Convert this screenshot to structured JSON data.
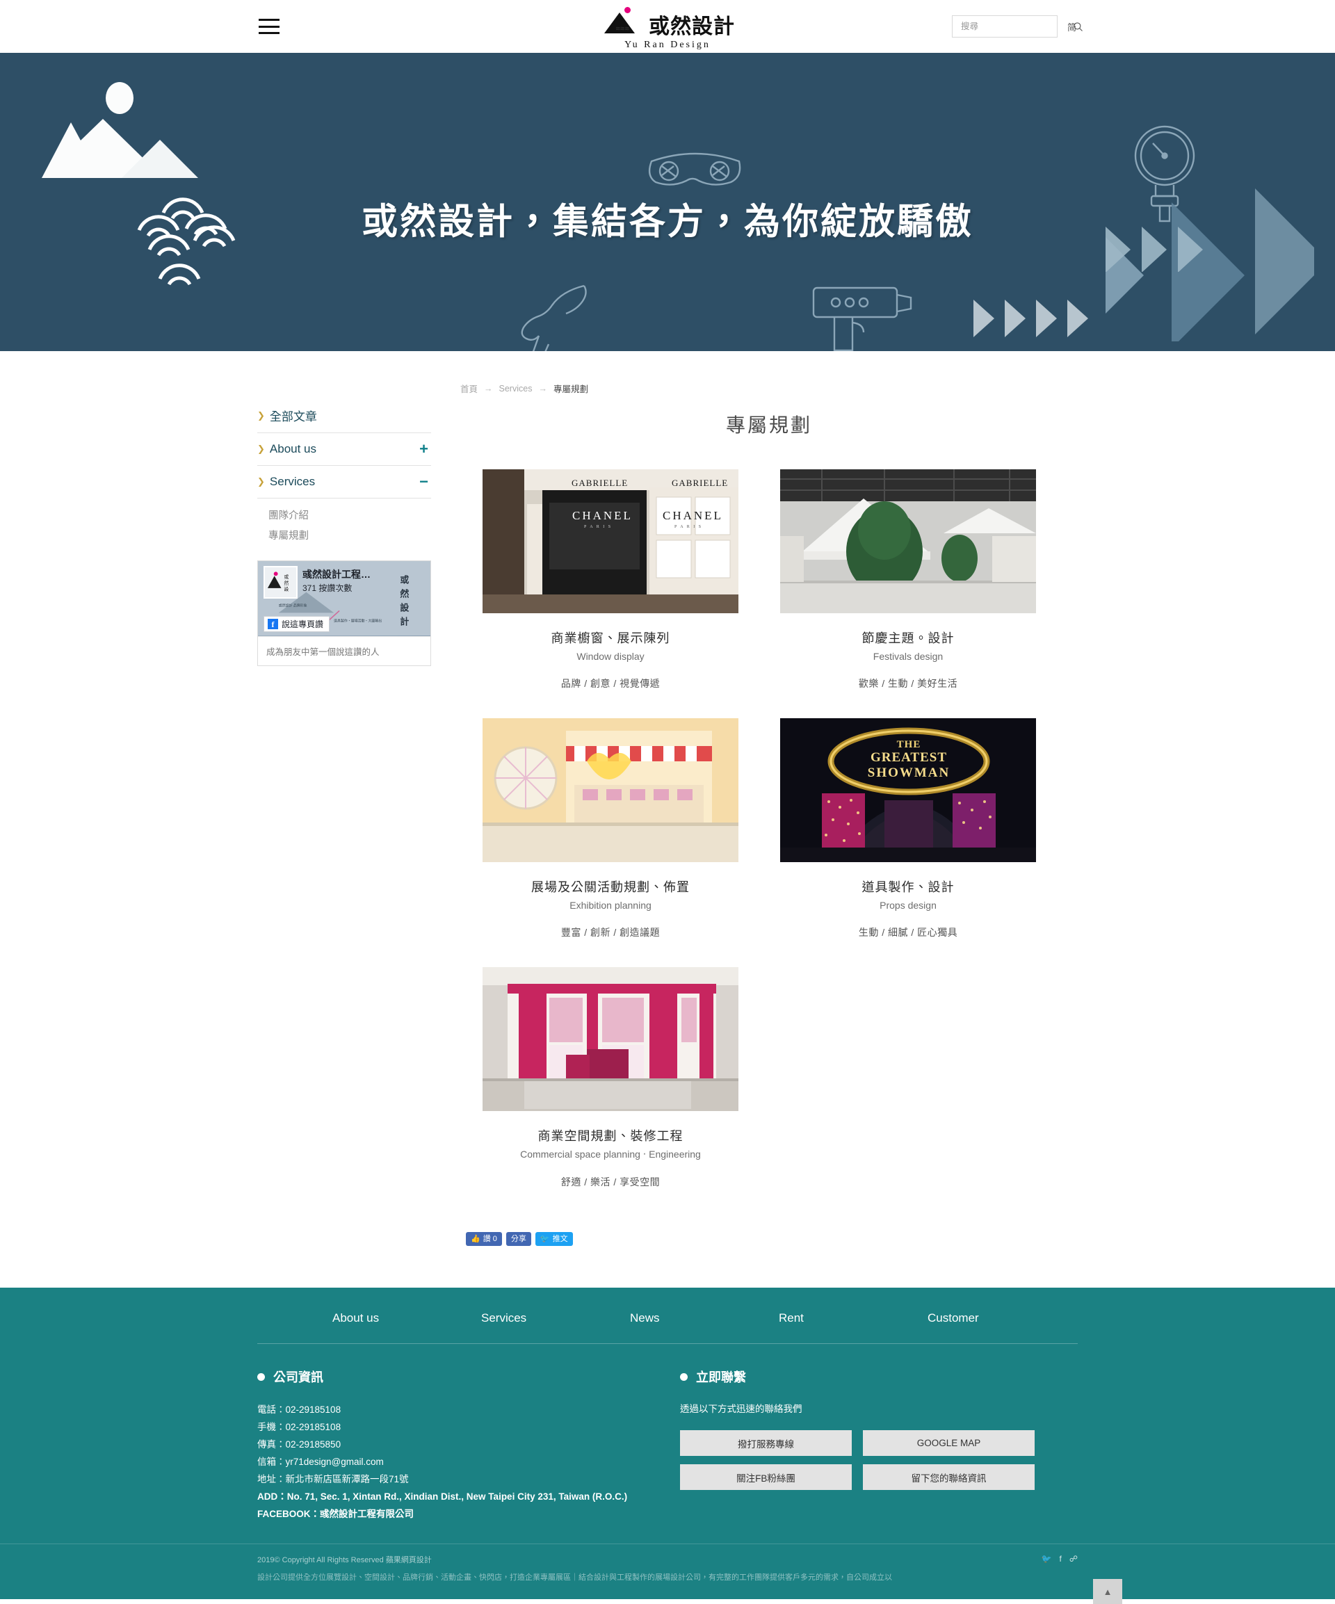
{
  "header": {
    "menu_icon": "hamburger-icon",
    "logo_cn": "或然設計",
    "logo_en": "Yu Ran Design",
    "search_placeholder": "搜尋",
    "search_value": "",
    "search_icon": "search-icon",
    "lang_toggle": "简"
  },
  "hero": {
    "title": "或然設計，集結各方，為你綻放驕傲",
    "bg_color": "#2e4f66"
  },
  "sidebar": {
    "items": [
      {
        "label": "全部文章",
        "toggle": ""
      },
      {
        "label": "About us",
        "toggle": "+"
      },
      {
        "label": "Services",
        "toggle": "−"
      }
    ],
    "sub_items": [
      "團隊介紹",
      "專屬規劃"
    ],
    "facebook": {
      "page_name": "彧然設計工程…",
      "likes": "371 按讚次數",
      "like_button": "說這專頁讚",
      "footer_text": "成為朋友中第一個說這讚的人"
    }
  },
  "breadcrumb": {
    "home": "首頁",
    "section": "Services",
    "current": "專屬規劃",
    "arrow": "→"
  },
  "main": {
    "page_title": "專屬規劃",
    "cards": [
      {
        "title_cn": "商業櫥窗、展示陳列",
        "title_en": "Window display",
        "tags": "品牌 / 創意 / 視覺傳遞",
        "image": "chanel-window-display-photo"
      },
      {
        "title_cn": "節慶主題。設計",
        "title_en": "Festivals design",
        "tags": "歡樂 / 生動 / 美好生活",
        "image": "christmas-mall-decoration-photo"
      },
      {
        "title_cn": "展場及公關活動規劃、佈置",
        "title_en": "Exhibition planning",
        "tags": "豐富 / 創新 / 創造議題",
        "image": "candy-booth-exhibition-photo"
      },
      {
        "title_cn": "道具製作、設計",
        "title_en": "Props design",
        "tags": "生動 / 細膩 / 匠心獨具",
        "image": "greatest-showman-archway-photo"
      },
      {
        "title_cn": "商業空間規劃、裝修工程",
        "title_en": "Commercial space planning ‧ Engineering",
        "tags": "舒適 / 樂活 / 享受空間",
        "image": "pink-retail-booth-photo"
      }
    ],
    "share": [
      {
        "label": "讚 0",
        "icon": "thumbs-up-icon",
        "network": "facebook-like"
      },
      {
        "label": "分享",
        "icon": "",
        "network": "facebook-share"
      },
      {
        "label": "推文",
        "icon": "twitter-bird-icon",
        "network": "twitter"
      }
    ]
  },
  "footer": {
    "bg_color": "#1b8183",
    "nav": [
      "About us",
      "Services",
      "News",
      "Rent",
      "Customer"
    ],
    "company": {
      "heading": "公司資訊",
      "lines": [
        "電話：02-29185108",
        "手機：02-29185108",
        "傳真：02-29185850",
        "信箱：yr71design@gmail.com",
        "地址：新北市新店區新潭路一段71號"
      ],
      "add_line": "ADD：No. 71, Sec. 1, Xintan Rd., Xindian Dist., New Taipei City 231, Taiwan (R.O.C.)",
      "fb_line": "FACEBOOK：彧然設計工程有限公司"
    },
    "contact": {
      "heading": "立即聯繫",
      "subtitle": "透過以下方式迅速的聯絡我們",
      "buttons": [
        "撥打服務專線",
        "GOOGLE MAP",
        "關注FB粉絲團",
        "留下您的聯絡資訊"
      ]
    },
    "copyright_line1": "2019© Copyright All Rights Reserved 蘋果網頁設計",
    "copyright_line2": "設計公司提供全方位展覽設計、空間設計、品牌行銷、活動企畫、快閃店，打造企業專屬展區｜結合設計與工程製作的展場設計公司，有完整的工作團隊提供客戶多元的需求，自公司成立以",
    "social_icons": [
      "twitter-icon",
      "facebook-icon",
      "rss-icon"
    ],
    "to_top": "▲"
  }
}
